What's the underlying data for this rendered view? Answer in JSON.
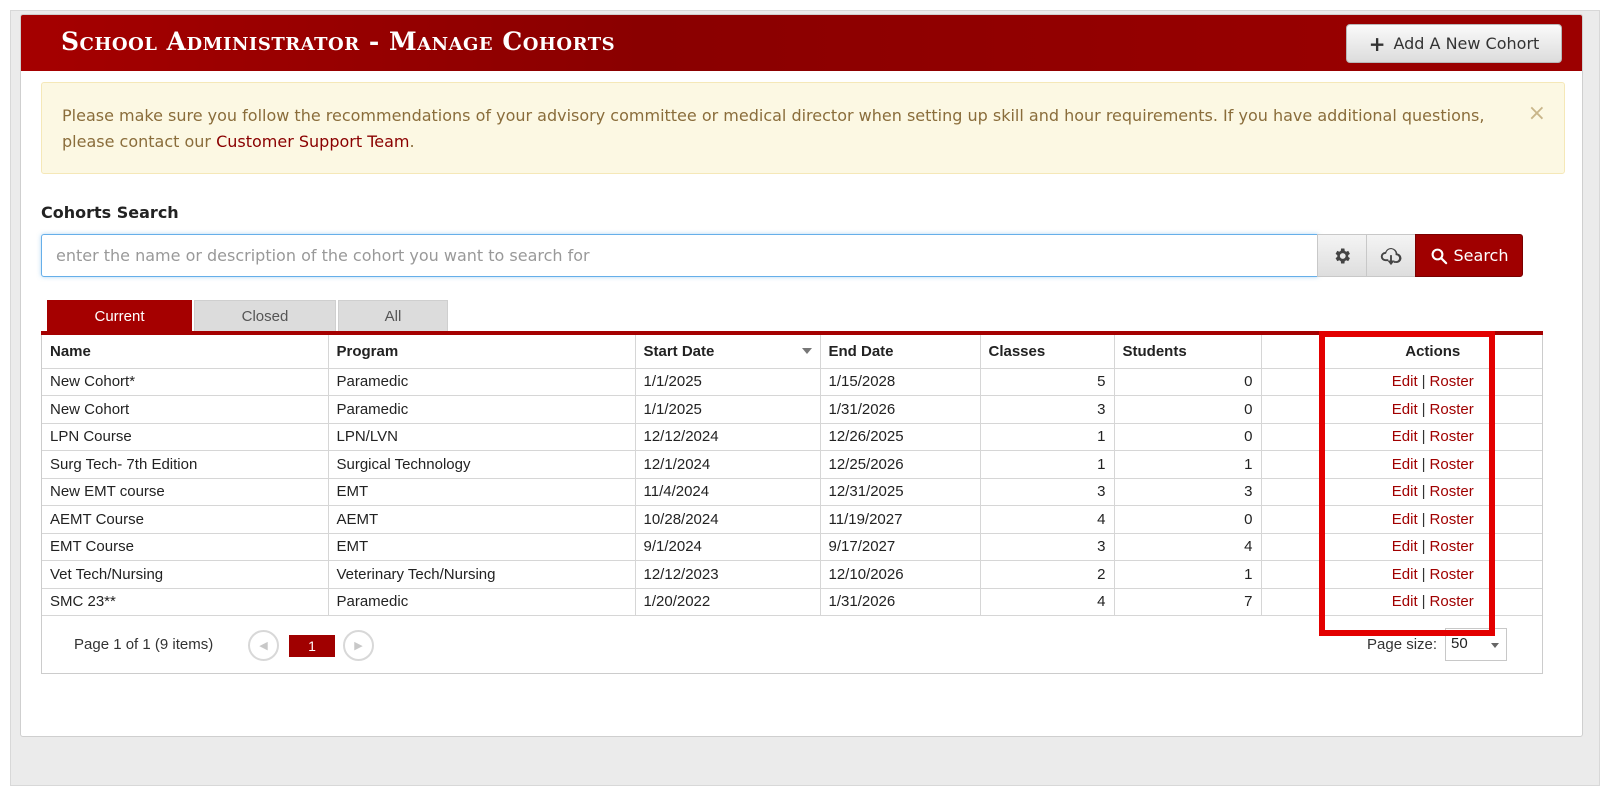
{
  "header": {
    "title": "School Administrator - Manage Cohorts",
    "add_button_label": "Add A New Cohort"
  },
  "alert": {
    "text_before": "Please make sure you follow the recommendations of your advisory committee or medical director when setting up skill and hour requirements. If you have additional questions, please contact our ",
    "link_text": "Customer Support Team",
    "text_after": ".",
    "close": "×"
  },
  "search": {
    "label": "Cohorts Search",
    "placeholder": "enter the name or description of the cohort you want to search for",
    "value": "",
    "button_label": "Search"
  },
  "tabs": [
    {
      "label": "Current",
      "active": true
    },
    {
      "label": "Closed",
      "active": false
    },
    {
      "label": "All",
      "active": false
    }
  ],
  "table": {
    "columns": [
      "Name",
      "Program",
      "Start Date",
      "End Date",
      "Classes",
      "Students",
      "",
      "Actions"
    ],
    "rows": [
      {
        "name": "New Cohort*",
        "program": "Paramedic",
        "start": "1/1/2025",
        "end": "1/15/2028",
        "classes": "5",
        "students": "0"
      },
      {
        "name": "New Cohort",
        "program": "Paramedic",
        "start": "1/1/2025",
        "end": "1/31/2026",
        "classes": "3",
        "students": "0"
      },
      {
        "name": "LPN Course",
        "program": "LPN/LVN",
        "start": "12/12/2024",
        "end": "12/26/2025",
        "classes": "1",
        "students": "0"
      },
      {
        "name": "Surg Tech- 7th Edition",
        "program": "Surgical Technology",
        "start": "12/1/2024",
        "end": "12/25/2026",
        "classes": "1",
        "students": "1"
      },
      {
        "name": "New EMT course",
        "program": "EMT",
        "start": "11/4/2024",
        "end": "12/31/2025",
        "classes": "3",
        "students": "3"
      },
      {
        "name": "AEMT Course",
        "program": "AEMT",
        "start": "10/28/2024",
        "end": "11/19/2027",
        "classes": "4",
        "students": "0"
      },
      {
        "name": "EMT Course",
        "program": "EMT",
        "start": "9/1/2024",
        "end": "9/17/2027",
        "classes": "3",
        "students": "4"
      },
      {
        "name": "Vet Tech/Nursing",
        "program": "Veterinary Tech/Nursing",
        "start": "12/12/2023",
        "end": "12/10/2026",
        "classes": "2",
        "students": "1"
      },
      {
        "name": "SMC 23**",
        "program": "Paramedic",
        "start": "1/20/2022",
        "end": "1/31/2026",
        "classes": "4",
        "students": "7"
      }
    ],
    "edit_label": "Edit",
    "separator": "|",
    "roster_label": "Roster"
  },
  "pager": {
    "info": "Page 1 of 1 (9 items)",
    "current_page": "1",
    "page_size_label": "Page size:",
    "page_size_value": "50"
  },
  "colors": {
    "brand_red": "#a50000",
    "highlight_red": "#e30000",
    "alert_bg": "#fcf8e3"
  }
}
